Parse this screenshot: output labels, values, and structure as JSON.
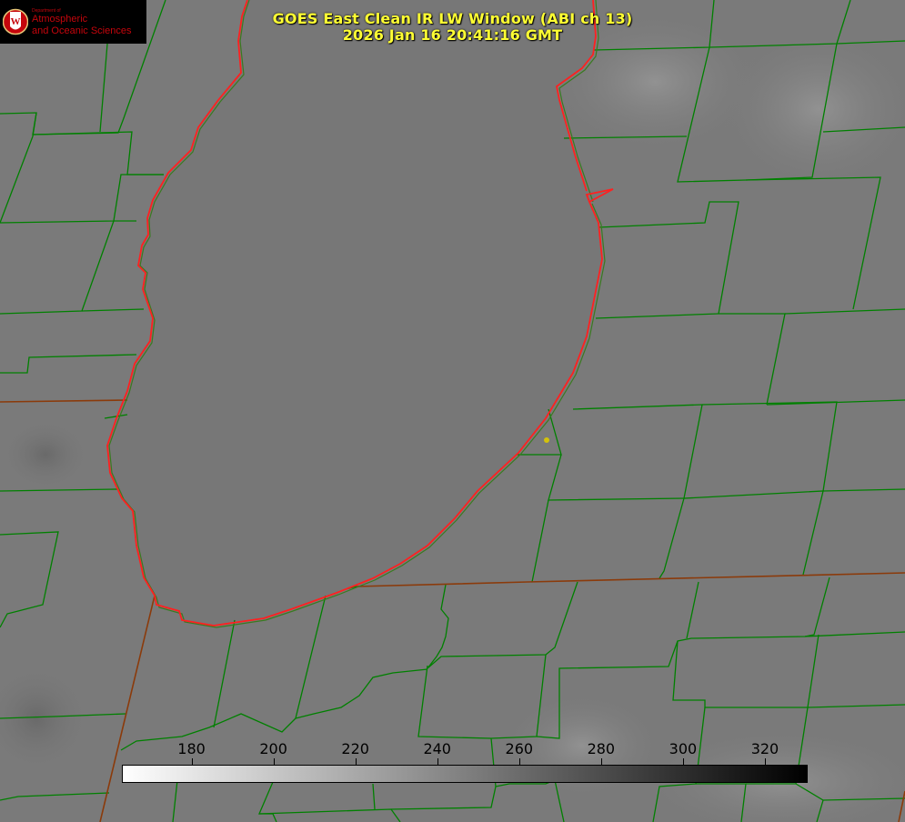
{
  "header": {
    "title": "GOES East Clean IR LW Window (ABI ch 13)",
    "timestamp": "2026 Jan 16 20:41:16 GMT"
  },
  "logo": {
    "department": "Department of",
    "line1": "Atmospheric",
    "line2": "and Oceanic Sciences",
    "emblem_text": "W"
  },
  "colorbar": {
    "min": 163,
    "max": 330,
    "tick_labels": [
      "180",
      "200",
      "220",
      "240",
      "260",
      "280",
      "300",
      "320"
    ],
    "tick_values": [
      180,
      200,
      220,
      240,
      260,
      280,
      300,
      320
    ],
    "color_low": "#ffffff",
    "color_high": "#000000"
  },
  "map": {
    "background": "#7a7a7a",
    "lake_fill": "#767676",
    "county_color": "#008000",
    "state_color": "#8b2a0a",
    "coast_color": "#ff2020",
    "marker_color": "#d4c20a"
  }
}
